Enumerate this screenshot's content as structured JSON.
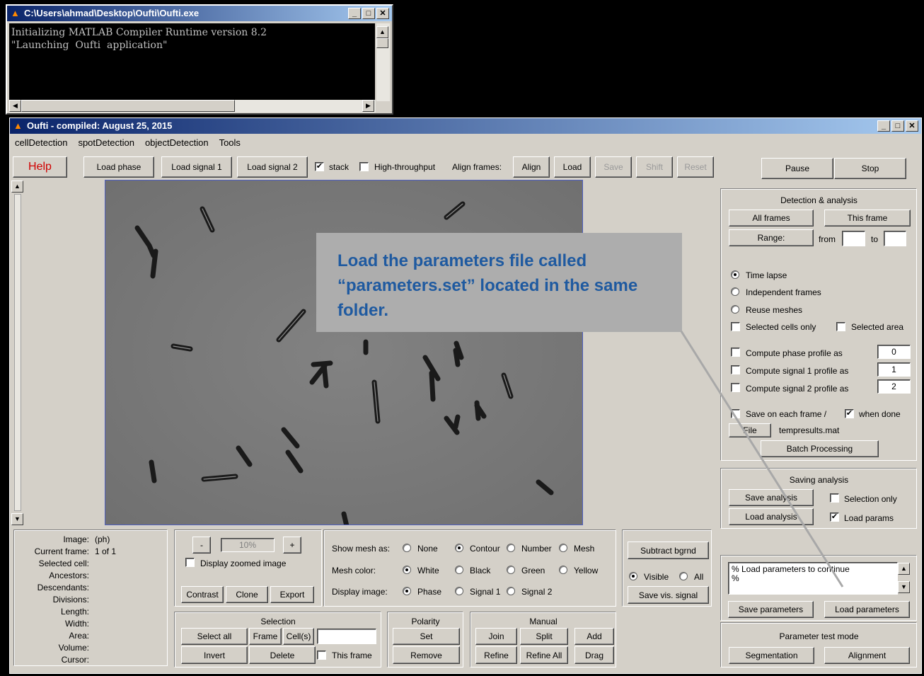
{
  "console": {
    "title": "C:\\Users\\ahmad\\Desktop\\Oufti\\Oufti.exe",
    "line1": "Initializing MATLAB Compiler Runtime version 8.2",
    "line2": "\"Launching  Oufti  application\""
  },
  "window": {
    "title": "Oufti - compiled:  August 25, 2015",
    "menu": [
      "cellDetection",
      "spotDetection",
      "objectDetection",
      "Tools"
    ]
  },
  "toolbar": {
    "help": "Help",
    "load_phase": "Load phase",
    "load_signal1": "Load signal 1",
    "load_signal2": "Load signal 2",
    "stack": "stack",
    "high_throughput": "High-throughput",
    "align_frames": "Align frames:",
    "align": "Align",
    "load": "Load",
    "save": "Save",
    "shift": "Shift",
    "reset": "Reset",
    "pause": "Pause",
    "stop": "Stop"
  },
  "detection": {
    "title": "Detection & analysis",
    "all_frames": "All frames",
    "this_frame": "This frame",
    "range": "Range:",
    "from": "from",
    "to": "to",
    "time_lapse": "Time lapse",
    "independent_frames": "Independent frames",
    "reuse_meshes": "Reuse meshes",
    "selected_cells_only": "Selected cells only",
    "selected_area": "Selected area",
    "compute_phase": "Compute phase profile as",
    "compute_signal1": "Compute signal 1 profile as",
    "compute_signal2": "Compute signal 2 profile as",
    "phase_val": "0",
    "signal1_val": "1",
    "signal2_val": "2",
    "save_each_frame": "Save on each frame /",
    "when_done": "when done",
    "file": "File",
    "filename": "tempresults.mat",
    "batch": "Batch Processing"
  },
  "saving": {
    "title": "Saving analysis",
    "save_analysis": "Save analysis",
    "selection_only": "Selection only",
    "load_analysis": "Load analysis",
    "load_params": "Load params"
  },
  "params": {
    "text1": "% Load parameters to continue",
    "text2": "%",
    "save": "Save parameters",
    "load": "Load parameters",
    "test_title": "Parameter test mode",
    "segmentation": "Segmentation",
    "alignment": "Alignment"
  },
  "info": {
    "labels": [
      "Image:",
      "Current frame:",
      "Selected cell:",
      "Ancestors:",
      "Descendants:",
      "Divisions:",
      "Length:",
      "Width:",
      "Area:",
      "Volume:",
      "Cursor:"
    ],
    "image_val": "(ph)",
    "frame_val": "1 of 1"
  },
  "zoom": {
    "minus": "-",
    "value": "10%",
    "plus": "+",
    "display_zoomed": "Display zoomed image",
    "contrast": "Contrast",
    "clone": "Clone",
    "export": "Export"
  },
  "display": {
    "show_mesh": "Show mesh as:",
    "none": "None",
    "contour": "Contour",
    "number": "Number",
    "mesh": "Mesh",
    "mesh_color": "Mesh color:",
    "white": "White",
    "black": "Black",
    "green": "Green",
    "yellow": "Yellow",
    "display_image": "Display image:",
    "phase": "Phase",
    "signal1": "Signal 1",
    "signal2": "Signal 2"
  },
  "bg": {
    "subtract": "Subtract bgrnd",
    "visible": "Visible",
    "all": "All",
    "save_vis": "Save vis. signal"
  },
  "selection": {
    "title": "Selection",
    "select_all": "Select all",
    "frame": "Frame",
    "cells": "Cell(s)",
    "invert": "Invert",
    "delete": "Delete",
    "this_frame": "This frame"
  },
  "polarity": {
    "title": "Polarity",
    "set": "Set",
    "remove": "Remove"
  },
  "manual": {
    "title": "Manual",
    "join": "Join",
    "split": "Split",
    "add": "Add",
    "refine": "Refine",
    "refine_all": "Refine All",
    "drag": "Drag"
  },
  "callout": "Load the parameters file called “parameters.set” located in the same folder."
}
